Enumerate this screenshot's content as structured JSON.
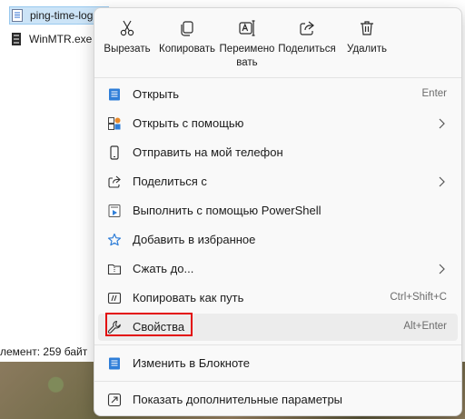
{
  "explorer": {
    "file_1": "ping-time-log",
    "file_2": "WinMTR.exe",
    "status": "лемент: 259 байт"
  },
  "quick_actions": [
    {
      "name": "cut",
      "icon": "scissors-icon",
      "label": "Вырезать"
    },
    {
      "name": "copy",
      "icon": "copy-icon",
      "label": "Копировать"
    },
    {
      "name": "rename",
      "icon": "rename-icon",
      "label": "Переименовать"
    },
    {
      "name": "share",
      "icon": "share-icon",
      "label": "Поделиться"
    },
    {
      "name": "delete",
      "icon": "trash-icon",
      "label": "Удалить"
    }
  ],
  "menu_items": [
    {
      "name": "open",
      "icon": "notepad-icon",
      "label": "Открыть",
      "shortcut": "Enter"
    },
    {
      "name": "open-with",
      "icon": "open-with-icon",
      "label": "Открыть с помощью",
      "submenu": true
    },
    {
      "name": "send-to-phone",
      "icon": "phone-icon",
      "label": "Отправить на мой телефон"
    },
    {
      "name": "share-with",
      "icon": "share-icon",
      "label": "Поделиться с",
      "submenu": true
    },
    {
      "name": "run-powershell",
      "icon": "powershell-icon",
      "label": "Выполнить с помощью PowerShell"
    },
    {
      "name": "add-favorites",
      "icon": "star-icon",
      "label": "Добавить в избранное"
    },
    {
      "name": "compress",
      "icon": "zip-folder-icon",
      "label": "Сжать до...",
      "submenu": true
    },
    {
      "name": "copy-path",
      "icon": "copy-path-icon",
      "label": "Копировать как путь",
      "shortcut": "Ctrl+Shift+C"
    },
    {
      "name": "properties",
      "icon": "wrench-icon",
      "label": "Свойства",
      "shortcut": "Alt+Enter"
    },
    {
      "name": "edit-notepad",
      "icon": "notepad-icon",
      "label": "Изменить в Блокноте"
    },
    {
      "name": "more-options",
      "icon": "more-options-icon",
      "label": "Показать дополнительные параметры"
    }
  ],
  "colors": {
    "accent": "#0067c0",
    "highlight": "#e30a0a"
  }
}
